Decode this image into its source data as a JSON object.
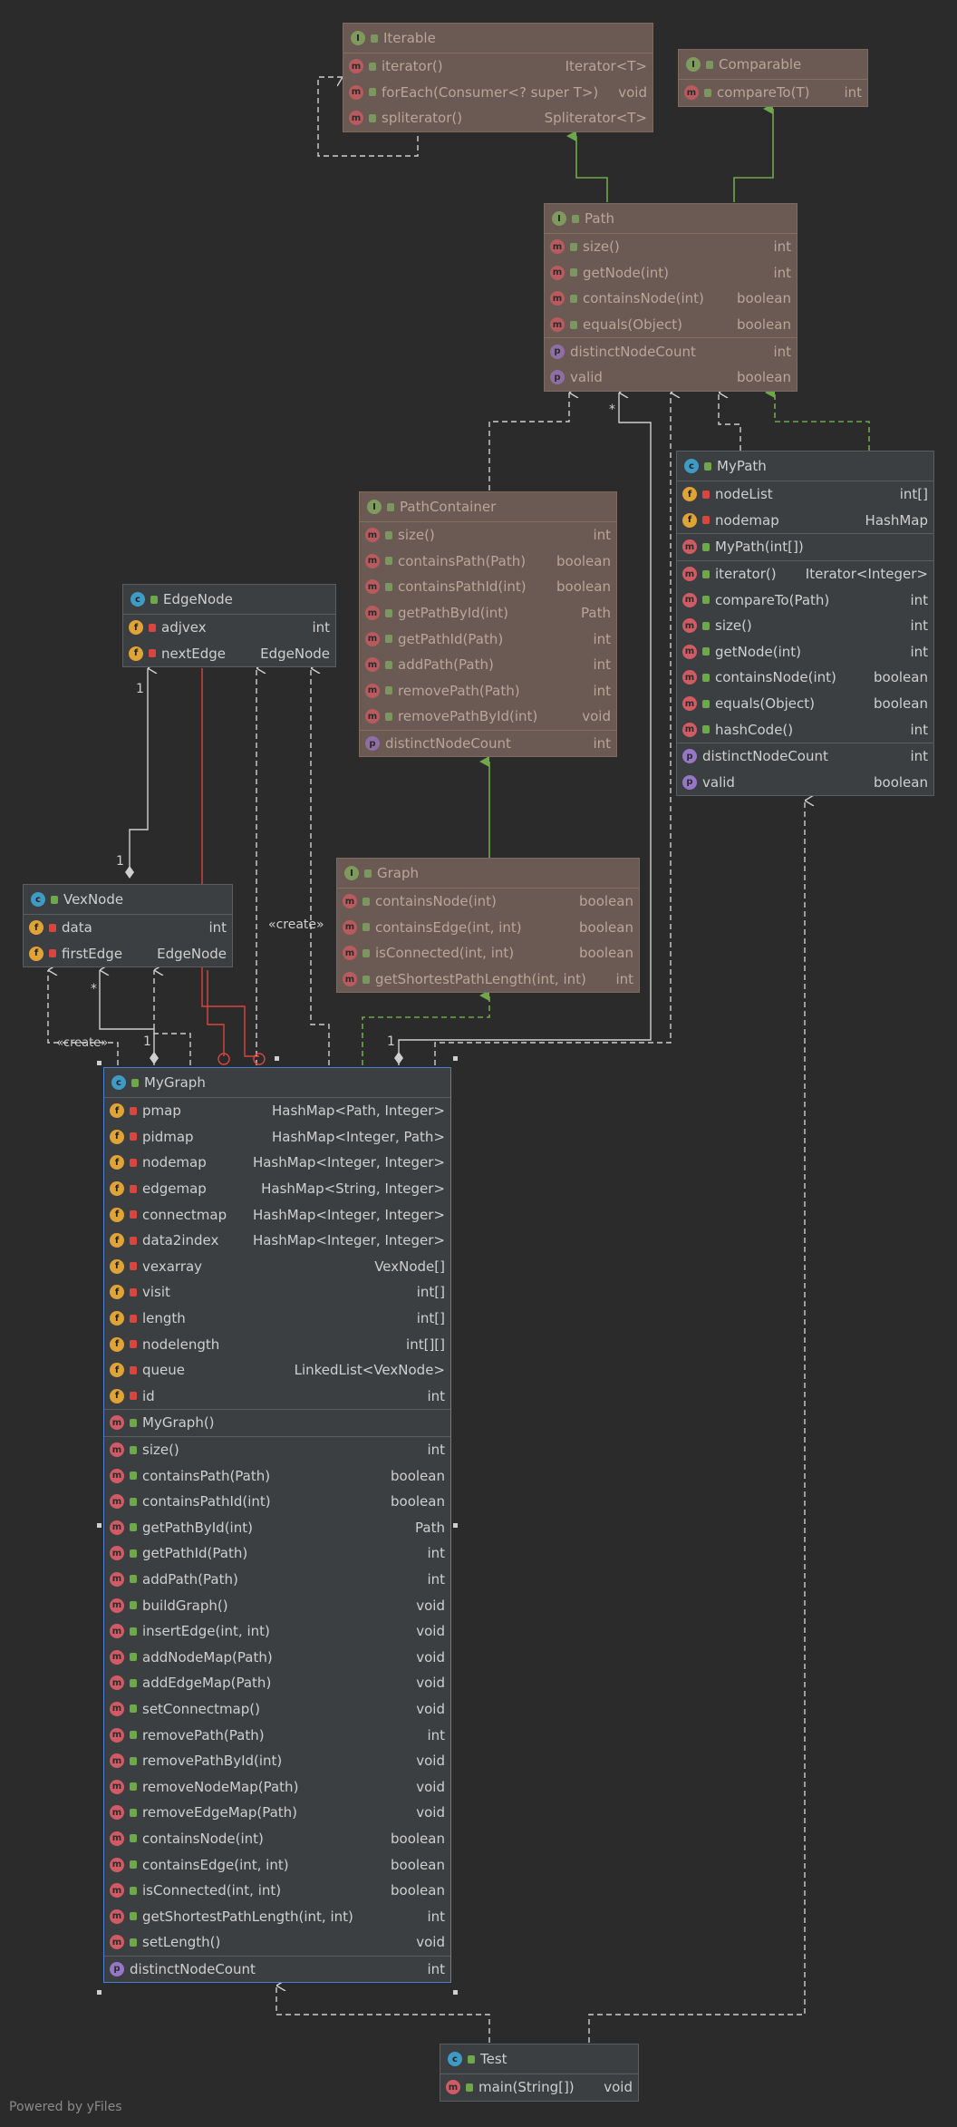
{
  "footer": "Powered by yFiles",
  "labels": {
    "create1": "«create»",
    "create2": "«create»",
    "mult_1a": "1",
    "mult_1b": "1",
    "mult_1c": "1",
    "mult_1d": "1",
    "mult_star1": "*",
    "mult_star2": "*"
  },
  "classes": {
    "iterable": {
      "name": "Iterable",
      "kind": "I",
      "rows": [
        {
          "k": "m",
          "n": "iterator()",
          "t": "Iterator<T>"
        },
        {
          "k": "m",
          "n": "forEach(Consumer<? super T>)",
          "t": "void"
        },
        {
          "k": "m",
          "n": "spliterator()",
          "t": "Spliterator<T>"
        }
      ]
    },
    "comparable": {
      "name": "Comparable",
      "kind": "I",
      "rows": [
        {
          "k": "m",
          "n": "compareTo(T)",
          "t": "int"
        }
      ]
    },
    "path": {
      "name": "Path",
      "kind": "I",
      "rows": [
        {
          "k": "m",
          "n": "size()",
          "t": "int"
        },
        {
          "k": "m",
          "n": "getNode(int)",
          "t": "int"
        },
        {
          "k": "m",
          "n": "containsNode(int)",
          "t": "boolean"
        },
        {
          "k": "m",
          "n": "equals(Object)",
          "t": "boolean"
        },
        {
          "k": "p",
          "n": "distinctNodeCount",
          "t": "int",
          "sep": true
        },
        {
          "k": "p",
          "n": "valid",
          "t": "boolean"
        }
      ]
    },
    "mypath": {
      "name": "MyPath",
      "kind": "C",
      "rows": [
        {
          "k": "f",
          "n": "nodeList",
          "t": "int[]"
        },
        {
          "k": "f",
          "n": "nodemap",
          "t": "HashMap"
        },
        {
          "k": "m",
          "n": "MyPath(int[])",
          "t": "",
          "sep": true
        },
        {
          "k": "m",
          "n": "iterator()",
          "t": "Iterator<Integer>",
          "sep": true
        },
        {
          "k": "m",
          "n": "compareTo(Path)",
          "t": "int"
        },
        {
          "k": "m",
          "n": "size()",
          "t": "int"
        },
        {
          "k": "m",
          "n": "getNode(int)",
          "t": "int"
        },
        {
          "k": "m",
          "n": "containsNode(int)",
          "t": "boolean"
        },
        {
          "k": "m",
          "n": "equals(Object)",
          "t": "boolean"
        },
        {
          "k": "m",
          "n": "hashCode()",
          "t": "int"
        },
        {
          "k": "p",
          "n": "distinctNodeCount",
          "t": "int",
          "sep": true
        },
        {
          "k": "p",
          "n": "valid",
          "t": "boolean"
        }
      ]
    },
    "pathcontainer": {
      "name": "PathContainer",
      "kind": "I",
      "rows": [
        {
          "k": "m",
          "n": "size()",
          "t": "int"
        },
        {
          "k": "m",
          "n": "containsPath(Path)",
          "t": "boolean"
        },
        {
          "k": "m",
          "n": "containsPathId(int)",
          "t": "boolean"
        },
        {
          "k": "m",
          "n": "getPathById(int)",
          "t": "Path"
        },
        {
          "k": "m",
          "n": "getPathId(Path)",
          "t": "int"
        },
        {
          "k": "m",
          "n": "addPath(Path)",
          "t": "int"
        },
        {
          "k": "m",
          "n": "removePath(Path)",
          "t": "int"
        },
        {
          "k": "m",
          "n": "removePathById(int)",
          "t": "void"
        },
        {
          "k": "p",
          "n": "distinctNodeCount",
          "t": "int",
          "sep": true
        }
      ]
    },
    "edgenode": {
      "name": "EdgeNode",
      "kind": "C",
      "rows": [
        {
          "k": "f",
          "n": "adjvex",
          "t": "int"
        },
        {
          "k": "f",
          "n": "nextEdge",
          "t": "EdgeNode"
        }
      ]
    },
    "vexnode": {
      "name": "VexNode",
      "kind": "C",
      "rows": [
        {
          "k": "f",
          "n": "data",
          "t": "int"
        },
        {
          "k": "f",
          "n": "firstEdge",
          "t": "EdgeNode"
        }
      ]
    },
    "graph": {
      "name": "Graph",
      "kind": "I",
      "rows": [
        {
          "k": "m",
          "n": "containsNode(int)",
          "t": "boolean"
        },
        {
          "k": "m",
          "n": "containsEdge(int, int)",
          "t": "boolean"
        },
        {
          "k": "m",
          "n": "isConnected(int, int)",
          "t": "boolean"
        },
        {
          "k": "m",
          "n": "getShortestPathLength(int, int)",
          "t": "int"
        }
      ]
    },
    "mygraph": {
      "name": "MyGraph",
      "kind": "C",
      "rows": [
        {
          "k": "f",
          "n": "pmap",
          "t": "HashMap<Path, Integer>"
        },
        {
          "k": "f",
          "n": "pidmap",
          "t": "HashMap<Integer, Path>"
        },
        {
          "k": "f",
          "n": "nodemap",
          "t": "HashMap<Integer, Integer>"
        },
        {
          "k": "f",
          "n": "edgemap",
          "t": "HashMap<String, Integer>"
        },
        {
          "k": "f",
          "n": "connectmap",
          "t": "HashMap<Integer, Integer>"
        },
        {
          "k": "f",
          "n": "data2index",
          "t": "HashMap<Integer, Integer>"
        },
        {
          "k": "f",
          "n": "vexarray",
          "t": "VexNode[]"
        },
        {
          "k": "f",
          "n": "visit",
          "t": "int[]"
        },
        {
          "k": "f",
          "n": "length",
          "t": "int[]"
        },
        {
          "k": "f",
          "n": "nodelength",
          "t": "int[][]"
        },
        {
          "k": "f",
          "n": "queue",
          "t": "LinkedList<VexNode>"
        },
        {
          "k": "f",
          "n": "id",
          "t": "int"
        },
        {
          "k": "m",
          "n": "MyGraph()",
          "t": "",
          "sep": true
        },
        {
          "k": "m",
          "n": "size()",
          "t": "int",
          "sep": true
        },
        {
          "k": "m",
          "n": "containsPath(Path)",
          "t": "boolean"
        },
        {
          "k": "m",
          "n": "containsPathId(int)",
          "t": "boolean"
        },
        {
          "k": "m",
          "n": "getPathById(int)",
          "t": "Path"
        },
        {
          "k": "m",
          "n": "getPathId(Path)",
          "t": "int"
        },
        {
          "k": "m",
          "n": "addPath(Path)",
          "t": "int"
        },
        {
          "k": "m",
          "n": "buildGraph()",
          "t": "void"
        },
        {
          "k": "m",
          "n": "insertEdge(int, int)",
          "t": "void"
        },
        {
          "k": "m",
          "n": "addNodeMap(Path)",
          "t": "void"
        },
        {
          "k": "m",
          "n": "addEdgeMap(Path)",
          "t": "void"
        },
        {
          "k": "m",
          "n": "setConnectmap()",
          "t": "void"
        },
        {
          "k": "m",
          "n": "removePath(Path)",
          "t": "int"
        },
        {
          "k": "m",
          "n": "removePathById(int)",
          "t": "void"
        },
        {
          "k": "m",
          "n": "removeNodeMap(Path)",
          "t": "void"
        },
        {
          "k": "m",
          "n": "removeEdgeMap(Path)",
          "t": "void"
        },
        {
          "k": "m",
          "n": "containsNode(int)",
          "t": "boolean"
        },
        {
          "k": "m",
          "n": "containsEdge(int, int)",
          "t": "boolean"
        },
        {
          "k": "m",
          "n": "isConnected(int, int)",
          "t": "boolean"
        },
        {
          "k": "m",
          "n": "getShortestPathLength(int, int)",
          "t": "int"
        },
        {
          "k": "m",
          "n": "setLength()",
          "t": "void"
        },
        {
          "k": "p",
          "n": "distinctNodeCount",
          "t": "int",
          "sep": true
        }
      ]
    },
    "test": {
      "name": "Test",
      "kind": "C",
      "rows": [
        {
          "k": "m",
          "n": "main(String[])",
          "t": "void"
        }
      ]
    }
  },
  "colors": {
    "bg": "#2b2b2b",
    "box": "#3c3f41",
    "dim_box": "#6b5a53",
    "realize": "#6fa84a",
    "dep": "#cfcfcf",
    "assoc": "#d9453f"
  }
}
